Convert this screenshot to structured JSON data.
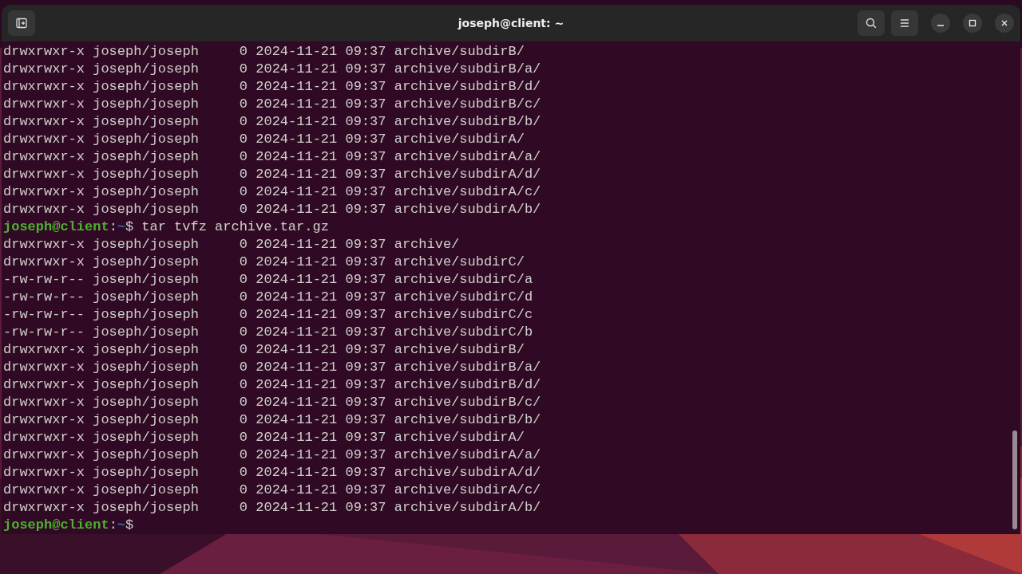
{
  "window": {
    "title": "joseph@client: ~"
  },
  "lines": [
    {
      "kind": "output",
      "text": "drwxrwxr-x joseph/joseph     0 2024-11-21 09:37 archive/subdirB/"
    },
    {
      "kind": "output",
      "text": "drwxrwxr-x joseph/joseph     0 2024-11-21 09:37 archive/subdirB/a/"
    },
    {
      "kind": "output",
      "text": "drwxrwxr-x joseph/joseph     0 2024-11-21 09:37 archive/subdirB/d/"
    },
    {
      "kind": "output",
      "text": "drwxrwxr-x joseph/joseph     0 2024-11-21 09:37 archive/subdirB/c/"
    },
    {
      "kind": "output",
      "text": "drwxrwxr-x joseph/joseph     0 2024-11-21 09:37 archive/subdirB/b/"
    },
    {
      "kind": "output",
      "text": "drwxrwxr-x joseph/joseph     0 2024-11-21 09:37 archive/subdirA/"
    },
    {
      "kind": "output",
      "text": "drwxrwxr-x joseph/joseph     0 2024-11-21 09:37 archive/subdirA/a/"
    },
    {
      "kind": "output",
      "text": "drwxrwxr-x joseph/joseph     0 2024-11-21 09:37 archive/subdirA/d/"
    },
    {
      "kind": "output",
      "text": "drwxrwxr-x joseph/joseph     0 2024-11-21 09:37 archive/subdirA/c/"
    },
    {
      "kind": "output",
      "text": "drwxrwxr-x joseph/joseph     0 2024-11-21 09:37 archive/subdirA/b/"
    },
    {
      "kind": "prompt",
      "user_host": "joseph@client",
      "separator": ":",
      "path": "~",
      "symbol": "$",
      "command": "tar tvfz archive.tar.gz"
    },
    {
      "kind": "output",
      "text": "drwxrwxr-x joseph/joseph     0 2024-11-21 09:37 archive/"
    },
    {
      "kind": "output",
      "text": "drwxrwxr-x joseph/joseph     0 2024-11-21 09:37 archive/subdirC/"
    },
    {
      "kind": "output",
      "text": "-rw-rw-r-- joseph/joseph     0 2024-11-21 09:37 archive/subdirC/a"
    },
    {
      "kind": "output",
      "text": "-rw-rw-r-- joseph/joseph     0 2024-11-21 09:37 archive/subdirC/d"
    },
    {
      "kind": "output",
      "text": "-rw-rw-r-- joseph/joseph     0 2024-11-21 09:37 archive/subdirC/c"
    },
    {
      "kind": "output",
      "text": "-rw-rw-r-- joseph/joseph     0 2024-11-21 09:37 archive/subdirC/b"
    },
    {
      "kind": "output",
      "text": "drwxrwxr-x joseph/joseph     0 2024-11-21 09:37 archive/subdirB/"
    },
    {
      "kind": "output",
      "text": "drwxrwxr-x joseph/joseph     0 2024-11-21 09:37 archive/subdirB/a/"
    },
    {
      "kind": "output",
      "text": "drwxrwxr-x joseph/joseph     0 2024-11-21 09:37 archive/subdirB/d/"
    },
    {
      "kind": "output",
      "text": "drwxrwxr-x joseph/joseph     0 2024-11-21 09:37 archive/subdirB/c/"
    },
    {
      "kind": "output",
      "text": "drwxrwxr-x joseph/joseph     0 2024-11-21 09:37 archive/subdirB/b/"
    },
    {
      "kind": "output",
      "text": "drwxrwxr-x joseph/joseph     0 2024-11-21 09:37 archive/subdirA/"
    },
    {
      "kind": "output",
      "text": "drwxrwxr-x joseph/joseph     0 2024-11-21 09:37 archive/subdirA/a/"
    },
    {
      "kind": "output",
      "text": "drwxrwxr-x joseph/joseph     0 2024-11-21 09:37 archive/subdirA/d/"
    },
    {
      "kind": "output",
      "text": "drwxrwxr-x joseph/joseph     0 2024-11-21 09:37 archive/subdirA/c/"
    },
    {
      "kind": "output",
      "text": "drwxrwxr-x joseph/joseph     0 2024-11-21 09:37 archive/subdirA/b/"
    },
    {
      "kind": "prompt",
      "user_host": "joseph@client",
      "separator": ":",
      "path": "~",
      "symbol": "$"
    }
  ]
}
